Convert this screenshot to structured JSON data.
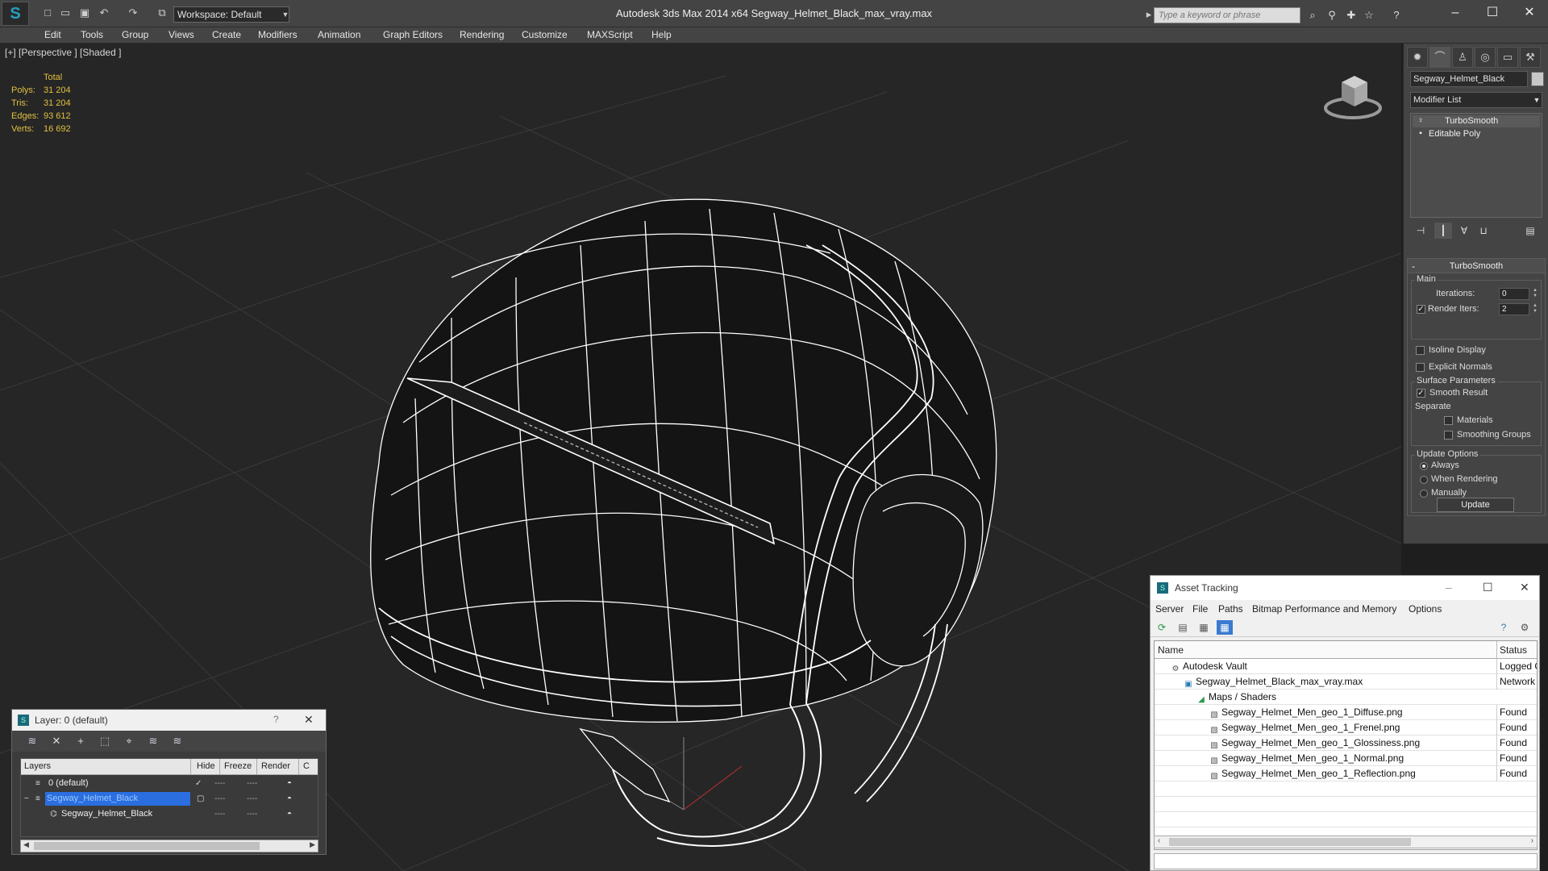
{
  "app": {
    "workspace": "Workspace: Default",
    "title": "Autodesk 3ds Max  2014 x64      Segway_Helmet_Black_max_vray.max",
    "search_placeholder": "Type a keyword or phrase"
  },
  "menu": [
    "Edit",
    "Tools",
    "Group",
    "Views",
    "Create",
    "Modifiers",
    "Animation",
    "Graph Editors",
    "Rendering",
    "Customize",
    "MAXScript",
    "Help"
  ],
  "viewport": {
    "label": "[+] [Perspective ] [Shaded ]",
    "stats": {
      "header": "Total",
      "rows": [
        {
          "label": "Polys:",
          "value": "31 204"
        },
        {
          "label": "Tris:",
          "value": "31 204"
        },
        {
          "label": "Edges:",
          "value": "93 612"
        },
        {
          "label": "Verts:",
          "value": "16 692"
        }
      ]
    }
  },
  "command_panel": {
    "object_name": "Segway_Helmet_Black",
    "modifier_list": "Modifier List",
    "stack": [
      "TurboSmooth",
      "Editable Poly"
    ],
    "rollout_title": "TurboSmooth",
    "main_group": "Main",
    "iterations_label": "Iterations:",
    "iterations_value": "0",
    "render_iters_label": "Render Iters:",
    "render_iters_value": "2",
    "render_iters_checked": true,
    "isoline_label": "Isoline Display",
    "isoline_checked": false,
    "explicit_normals_label": "Explicit Normals",
    "explicit_normals_checked": false,
    "surface_group": "Surface Parameters",
    "smooth_result_label": "Smooth Result",
    "smooth_result_checked": true,
    "separate_label": "Separate",
    "materials_label": "Materials",
    "materials_checked": false,
    "smoothing_groups_label": "Smoothing Groups",
    "smoothing_groups_checked": false,
    "update_group": "Update Options",
    "update_options": [
      {
        "label": "Always",
        "selected": true
      },
      {
        "label": "When Rendering",
        "selected": false
      },
      {
        "label": "Manually",
        "selected": false
      }
    ],
    "update_button": "Update"
  },
  "layer_dialog": {
    "title": "Layer: 0 (default)",
    "help": "?",
    "columns": [
      "Layers",
      "Hide",
      "Freeze",
      "Render",
      "C"
    ],
    "rows": [
      {
        "name": "0 (default)",
        "selected": false,
        "indent": 1
      },
      {
        "name": "Segway_Helmet_Black",
        "selected": true,
        "indent": 1
      },
      {
        "name": "Segway_Helmet_Black",
        "selected": false,
        "indent": 2
      }
    ]
  },
  "asset_tracking": {
    "title": "Asset Tracking",
    "menu": [
      "Server",
      "File",
      "Paths",
      "Bitmap Performance and Memory",
      "Options"
    ],
    "columns": [
      "Name",
      "Status"
    ],
    "rows": [
      {
        "name": "Autodesk Vault",
        "status": "Logged O",
        "indent": 1
      },
      {
        "name": "Segway_Helmet_Black_max_vray.max",
        "status": "Network",
        "indent": 2
      },
      {
        "name": "Maps / Shaders",
        "status": "",
        "indent": 3
      },
      {
        "name": "Segway_Helmet_Men_geo_1_Diffuse.png",
        "status": "Found",
        "indent": 4
      },
      {
        "name": "Segway_Helmet_Men_geo_1_Frenel.png",
        "status": "Found",
        "indent": 4
      },
      {
        "name": "Segway_Helmet_Men_geo_1_Glossiness.png",
        "status": "Found",
        "indent": 4
      },
      {
        "name": "Segway_Helmet_Men_geo_1_Normal.png",
        "status": "Found",
        "indent": 4
      },
      {
        "name": "Segway_Helmet_Men_geo_1_Reflection.png",
        "status": "Found",
        "indent": 4
      }
    ]
  },
  "colors": {
    "viewport_bg": "#262626",
    "wire": "#ffffff",
    "stats_text": "#e0c040",
    "selection": "#2a6ee0"
  }
}
